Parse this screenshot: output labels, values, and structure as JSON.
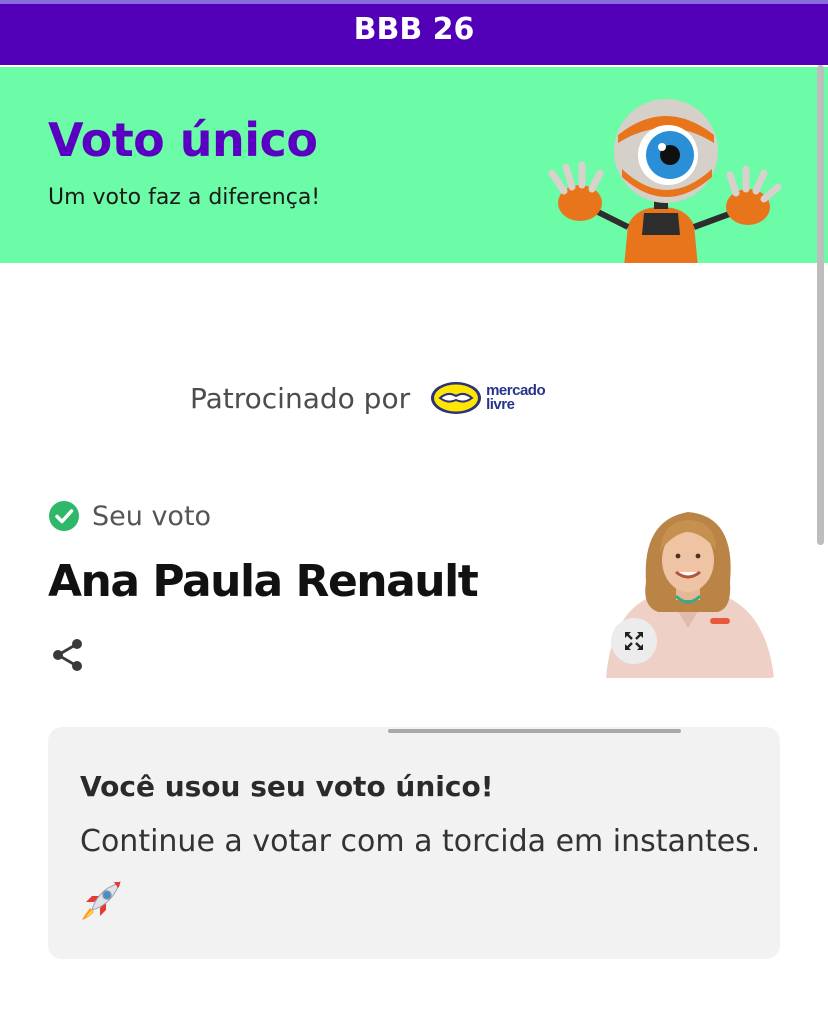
{
  "header": {
    "title": "BBB 26"
  },
  "hero": {
    "title": "Voto único",
    "subtitle": "Um voto faz a diferença!",
    "mascot_icon": "big-brother-eye-mascot"
  },
  "sponsor": {
    "label": "Patrocinado por",
    "brand_line1": "mercado",
    "brand_line2": "livre",
    "brand_icon": "handshake-icon"
  },
  "vote": {
    "status_label": "Seu voto",
    "status_icon": "check-circle-icon",
    "candidate_name": "Ana Paula Renault",
    "share_icon": "share-icon",
    "expand_icon": "expand-icon"
  },
  "card": {
    "title": "Você usou seu voto único!",
    "body": "Continue a votar com a torcida em instantes.",
    "emoji": "rocket-icon"
  },
  "colors": {
    "header_bg": "#5200b8",
    "hero_bg": "#6cfba6",
    "hero_title": "#5a00c2",
    "check": "#2fb86a",
    "card_bg": "#f2f2f2"
  }
}
